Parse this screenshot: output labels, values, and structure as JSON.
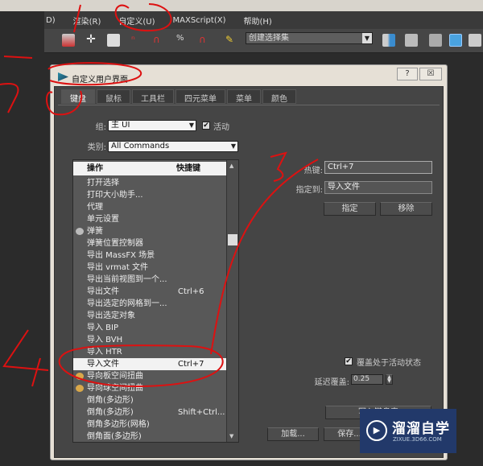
{
  "menubar": {
    "items": [
      "D)",
      "渲染(R)",
      "自定义(U)",
      "MAXScript(X)",
      "帮助(H)"
    ]
  },
  "toolbar": {
    "selection_set": "创建选择集"
  },
  "dialog": {
    "title": "自定义用户界面",
    "help_button": "?",
    "close_button": "☒",
    "tabs": [
      "键盘",
      "鼠标",
      "工具栏",
      "四元菜单",
      "菜单",
      "颜色"
    ],
    "group_label": "组:",
    "group_value": "主 UI",
    "active_label": "活动",
    "active_checked": true,
    "category_label": "类别:",
    "category_value": "All Commands",
    "list": {
      "headers": {
        "action": "操作",
        "shortcut": "快捷键"
      },
      "rows": [
        {
          "action": "打开选择",
          "shortcut": ""
        },
        {
          "action": "打印大小助手...",
          "shortcut": ""
        },
        {
          "action": "代理",
          "shortcut": ""
        },
        {
          "action": "单元设置",
          "shortcut": ""
        },
        {
          "action": "弹簧",
          "shortcut": ""
        },
        {
          "action": "弹簧位置控制器",
          "shortcut": ""
        },
        {
          "action": "导出 MassFX 场景",
          "shortcut": ""
        },
        {
          "action": "导出 vrmat 文件",
          "shortcut": ""
        },
        {
          "action": "导出当前视图到一个...",
          "shortcut": ""
        },
        {
          "action": "导出文件",
          "shortcut": "Ctrl+6"
        },
        {
          "action": "导出选定的网格到一...",
          "shortcut": ""
        },
        {
          "action": "导出选定对象",
          "shortcut": ""
        },
        {
          "action": "导入 BIP",
          "shortcut": ""
        },
        {
          "action": "导入 BVH",
          "shortcut": ""
        },
        {
          "action": "导入 HTR",
          "shortcut": ""
        },
        {
          "action": "导入文件",
          "shortcut": "Ctrl+7"
        },
        {
          "action": "导向板空间扭曲",
          "shortcut": ""
        },
        {
          "action": "导向球空间扭曲",
          "shortcut": ""
        },
        {
          "action": "倒角(多边形)",
          "shortcut": ""
        },
        {
          "action": "倒角(多边形)",
          "shortcut": "Shift+Ctrl..."
        },
        {
          "action": "倒角多边形(网格)",
          "shortcut": ""
        },
        {
          "action": "倒角面(多边形)",
          "shortcut": ""
        }
      ]
    },
    "hotkey_label": "热键:",
    "hotkey_value": "Ctrl+7",
    "assigned_label": "指定到:",
    "assigned_value": "导入文件",
    "assign_button": "指定",
    "remove_button": "移除",
    "override_label": "覆盖处于活动状态",
    "override_checked": true,
    "delay_label": "延迟覆盖:",
    "delay_value": "0.25",
    "write_button": "写入键盘表",
    "load_button": "加载...",
    "save_button": "保存..."
  },
  "watermark": {
    "title": "溜溜自学",
    "url": "ZIXUE.3D66.COM"
  }
}
